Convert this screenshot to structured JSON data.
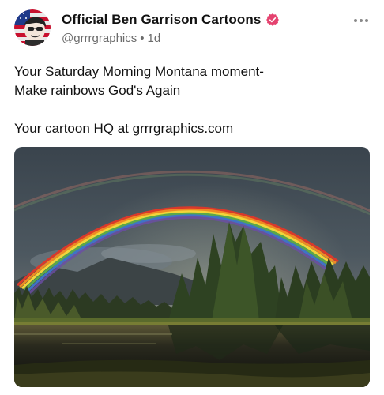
{
  "post": {
    "author": {
      "display_name": "Official  Ben Garrison Cartoons",
      "handle": "@grrrgraphics",
      "time_separator": "•",
      "timestamp": "1d",
      "verified": true,
      "verified_color": "#e5426f"
    },
    "more_menu_icon": "ellipsis-horizontal-icon",
    "text_lines": [
      "Your Saturday Morning Montana moment-",
      "Make rainbows God's Again",
      "",
      "Your cartoon HQ at grrrgraphics.com"
    ],
    "media": {
      "type": "photo",
      "subject": "double rainbow over a forest and lake"
    }
  }
}
